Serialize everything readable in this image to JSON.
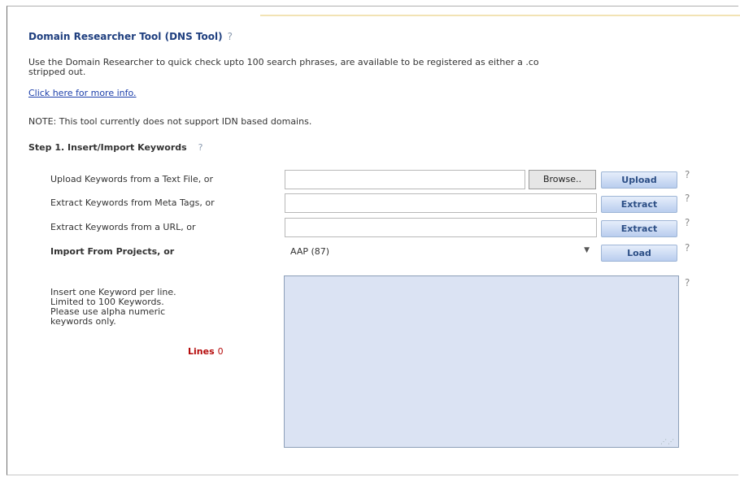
{
  "header": {
    "title": "Domain Researcher Tool (DNS Tool)",
    "help_mark": "?"
  },
  "intro": {
    "description": "Use the Domain Researcher to quick check upto 100 search phrases, are available to be registered as either a .co\nstripped out.",
    "link_text": "Click here for more info.",
    "note": "NOTE: This tool currently does not support IDN based domains."
  },
  "step1": {
    "title": "Step 1. Insert/Import Keywords",
    "help_mark": "?"
  },
  "rows": {
    "upload": {
      "label": "Upload Keywords from a Text File, or",
      "value": "",
      "browse_label": "Browse..",
      "button_label": "Upload",
      "help": "?"
    },
    "meta": {
      "label": "Extract Keywords from Meta Tags, or",
      "value": "",
      "button_label": "Extract",
      "help": "?"
    },
    "url": {
      "label": "Extract Keywords from a URL, or",
      "value": "",
      "button_label": "Extract",
      "help": "?"
    },
    "projects": {
      "label": "Import From Projects, or",
      "selected": "AAP (87)",
      "button_label": "Load",
      "help": "?"
    }
  },
  "keywords": {
    "hint": "Insert one Keyword per line.\nLimited to 100 Keywords.\nPlease use alpha numeric\nkeywords only.",
    "lines_label": "Lines",
    "lines_count": "0",
    "value": "",
    "help": "?"
  },
  "icons": {
    "dropdown": "chevron-down-icon",
    "resize": "resize-grip-icon"
  },
  "colors": {
    "title": "#1f3f7f",
    "link": "#1c3faa",
    "button_text": "#2d4f86",
    "textarea_bg": "#dbe3f3",
    "lines_label": "#b50b0b"
  }
}
